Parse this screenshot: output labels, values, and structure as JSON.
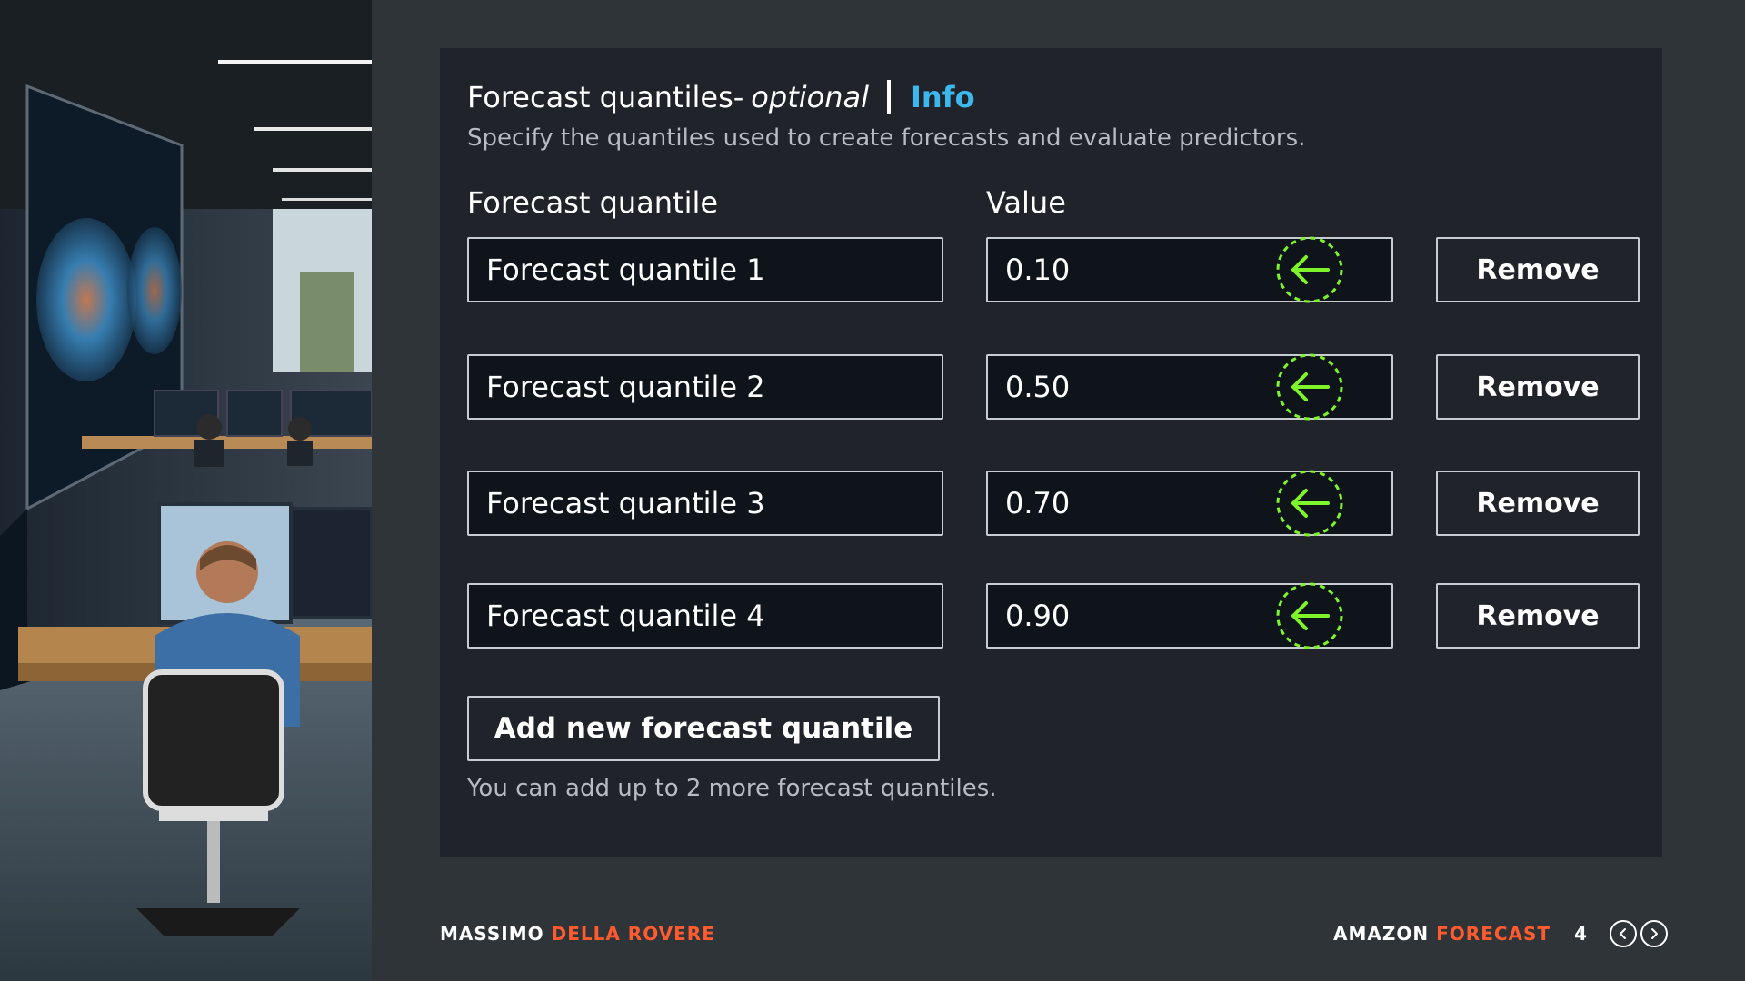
{
  "section": {
    "title": "Forecast quantiles-",
    "optional_label": "optional",
    "info_link": "Info",
    "description": "Specify the quantiles used to create forecasts and evaluate predictors."
  },
  "columns": {
    "quantile_header": "Forecast quantile",
    "value_header": "Value"
  },
  "quantiles": [
    {
      "name": "Forecast quantile 1",
      "value": "0.10",
      "remove_label": "Remove"
    },
    {
      "name": "Forecast quantile 2",
      "value": "0.50",
      "remove_label": "Remove"
    },
    {
      "name": "Forecast quantile 3",
      "value": "0.70",
      "remove_label": "Remove"
    },
    {
      "name": "Forecast quantile 4",
      "value": "0.90",
      "remove_label": "Remove"
    }
  ],
  "add_button_label": "Add new forecast quantile",
  "hint": "You can add up to 2 more forecast quantiles.",
  "footer": {
    "author_first": "MASSIMO",
    "author_last": "DELLA ROVERE",
    "product_first": "AMAZON",
    "product_last": "FORECAST",
    "page_number": "4"
  },
  "colors": {
    "background": "#2f3439",
    "panel": "#20242a",
    "field": "#0f141a",
    "info_link": "#3db8ef",
    "accent": "#ff5b2e",
    "marker": "#7ef52a"
  },
  "icons": {
    "marker": "left-arrow-dashed-circle-icon",
    "prev": "chevron-left-circle-icon",
    "next": "chevron-right-circle-icon"
  }
}
